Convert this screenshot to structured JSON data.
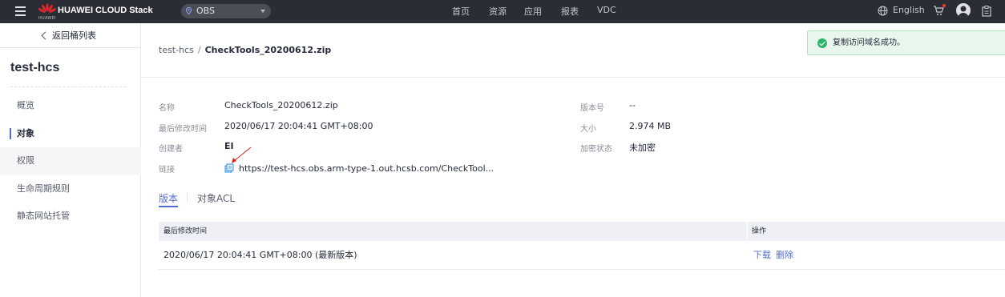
{
  "topbar": {
    "brand": "HUAWEI CLOUD Stack",
    "logo_text": "HUAWEI",
    "region": "OBS",
    "nav": [
      "首页",
      "资源",
      "应用",
      "报表",
      "VDC"
    ],
    "language": "English"
  },
  "sidebar": {
    "back": "返回桶列表",
    "bucket": "test-hcs",
    "items": [
      {
        "label": "概览"
      },
      {
        "label": "对象"
      },
      {
        "label": "权限"
      },
      {
        "label": "生命周期规则"
      },
      {
        "label": "静态网站托管"
      }
    ]
  },
  "breadcrumb": {
    "parent": "test-hcs",
    "separator": "/",
    "current": "CheckTools_20200612.zip"
  },
  "toast": "复制访问域名成功。",
  "details": {
    "name_label": "名称",
    "name": "CheckTools_20200612.zip",
    "modified_label": "最后修改时间",
    "modified": "2020/06/17 20:04:41 GMT+08:00",
    "creator_label": "创建者",
    "creator": "EI",
    "link_label": "链接",
    "link": "https://test-hcs.obs.arm-type-1.out.hcsb.com/CheckTool...",
    "version_label": "版本号",
    "version": "--",
    "size_label": "大小",
    "size": "2.974 MB",
    "encryption_label": "加密状态",
    "encryption": "未加密"
  },
  "tabs": [
    "版本",
    "对象ACL"
  ],
  "table": {
    "headers": [
      "最后修改时间",
      "操作"
    ],
    "rows": [
      {
        "modified": "2020/06/17 20:04:41 GMT+08:00 (最新版本)",
        "actions": [
          "下载",
          "删除"
        ]
      }
    ]
  },
  "colors": {
    "topbar": "#2a2d34",
    "accent": "#526ecc",
    "success": "#2fb36a",
    "arrow": "#e02020"
  }
}
